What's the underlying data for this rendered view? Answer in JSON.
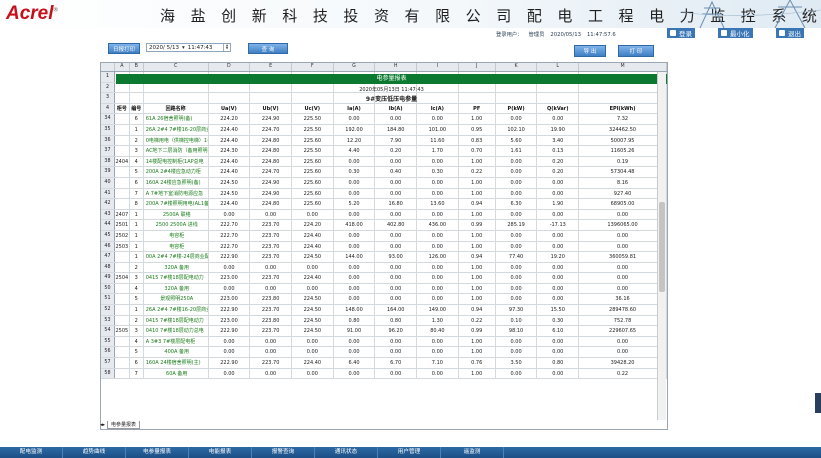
{
  "header": {
    "logo": "Acrel",
    "logo_mark": "®",
    "title": "海 盐 创 新 科 技 投 资 有 限 公 司 配 电 工 程 电 力 监 控 系 统",
    "user_label": "登录用户：",
    "user_name": "管理员",
    "date": "2020/05/13",
    "time": "11:47:57.6",
    "login": "登录",
    "minimize": "最小化",
    "logout": "退出"
  },
  "toolbar": {
    "report_type": "日报打印",
    "date_value": "2020/ 5/13",
    "time_value": "11:47:43",
    "query": "查 询",
    "export": "导 出",
    "print": "打 印"
  },
  "sheet": {
    "columns": [
      "A",
      "B",
      "C",
      "D",
      "E",
      "F",
      "G",
      "H",
      "I",
      "J",
      "K",
      "L",
      "M"
    ],
    "title": "电参量报表",
    "report_date": "2020年05月13日 11:47:43",
    "subtitle": "9#变压低压电参量",
    "headers": [
      "柜号",
      "编号",
      "回路名称",
      "Ua(V)",
      "Ub(V)",
      "Uc(V)",
      "Ia(A)",
      "Ib(A)",
      "Ic(A)",
      "PF",
      "P(kW)",
      "Q(kVar)",
      "EPI(kWh)"
    ],
    "rows": [
      {
        "rn": "34",
        "bus": "",
        "no": "6",
        "name": "61A 26宿舍照明(备)",
        "ua": "224.20",
        "ub": "224.90",
        "uc": "225.50",
        "ia": "0.00",
        "ib": "0.00",
        "ic": "0.00",
        "pf": "1.00",
        "p": "0.00",
        "q": "0.00",
        "epi": "7.32"
      },
      {
        "rn": "35",
        "bus": "",
        "no": "1",
        "name": "26A 2#4 7#楼16-20层商业配电",
        "ua": "224.40",
        "ub": "224.70",
        "uc": "225.50",
        "ia": "192.00",
        "ib": "184.80",
        "ic": "101.00",
        "pf": "0.95",
        "p": "102.10",
        "q": "19.90",
        "epi": "324462.50"
      },
      {
        "rn": "36",
        "bus": "",
        "no": "2",
        "name": "0电梯用电（供梯控电梯）1#-7",
        "ua": "224.40",
        "ub": "224.80",
        "uc": "225.60",
        "ia": "12.20",
        "ib": "7.90",
        "ic": "11.60",
        "pf": "0.83",
        "p": "5.60",
        "q": "3.40",
        "epi": "50007.95"
      },
      {
        "rn": "37",
        "bus": "",
        "no": "3",
        "name": "AC地下二层消防（备用照明）",
        "ua": "224.30",
        "ub": "224.80",
        "uc": "225.50",
        "ia": "4.40",
        "ib": "0.20",
        "ic": "1.70",
        "pf": "0.70",
        "p": "1.61",
        "q": "0.13",
        "epi": "11605.26"
      },
      {
        "rn": "38",
        "bus": "2404",
        "no": "4",
        "name": "14楼配电控制柜(1AP总电",
        "ua": "224.40",
        "ub": "224.80",
        "uc": "225.60",
        "ia": "0.00",
        "ib": "0.00",
        "ic": "0.00",
        "pf": "1.00",
        "p": "0.00",
        "q": "0.20",
        "epi": "0.19"
      },
      {
        "rn": "39",
        "bus": "",
        "no": "5",
        "name": "200A 2#4楼应急动力柜",
        "ua": "224.40",
        "ub": "224.70",
        "uc": "225.60",
        "ia": "0.30",
        "ib": "0.40",
        "ic": "0.30",
        "pf": "0.22",
        "p": "0.00",
        "q": "0.20",
        "epi": "57304.48"
      },
      {
        "rn": "40",
        "bus": "",
        "no": "6",
        "name": "160A 24楼应急照明(备)",
        "ua": "224.50",
        "ub": "224.90",
        "uc": "225.60",
        "ia": "0.00",
        "ib": "0.00",
        "ic": "0.00",
        "pf": "1.00",
        "p": "0.00",
        "q": "0.00",
        "epi": "8.16"
      },
      {
        "rn": "41",
        "bus": "",
        "no": "7",
        "name": "A 7#地下室消防电源应急",
        "ua": "224.50",
        "ub": "224.90",
        "uc": "225.60",
        "ia": "0.00",
        "ib": "0.00",
        "ic": "0.00",
        "pf": "1.00",
        "p": "0.00",
        "q": "0.00",
        "epi": "927.40"
      },
      {
        "rn": "42",
        "bus": "",
        "no": "8",
        "name": "200A 7#楼照明用电(AL1备)",
        "ua": "224.40",
        "ub": "224.80",
        "uc": "225.60",
        "ia": "5.20",
        "ib": "16.80",
        "ic": "13.60",
        "pf": "0.94",
        "p": "6.30",
        "q": "1.90",
        "epi": "68905.00"
      },
      {
        "rn": "43",
        "bus": "2407",
        "no": "1",
        "name": "2500A 联络",
        "ua": "0.00",
        "ub": "0.00",
        "uc": "0.00",
        "ia": "0.00",
        "ib": "0.00",
        "ic": "0.00",
        "pf": "1.00",
        "p": "0.00",
        "q": "0.00",
        "epi": "0.00",
        "center": true
      },
      {
        "rn": "44",
        "bus": "2501",
        "no": "1",
        "name": "2500 2500A 进线",
        "ua": "222.70",
        "ub": "223.70",
        "uc": "224.20",
        "ia": "418.00",
        "ib": "402.80",
        "ic": "436.00",
        "pf": "0.99",
        "p": "285.19",
        "q": "-17.13",
        "epi": "1396065.00",
        "center": true
      },
      {
        "rn": "45",
        "bus": "2502",
        "no": "1",
        "name": "电容柜",
        "ua": "222.70",
        "ub": "223.70",
        "uc": "224.40",
        "ia": "0.00",
        "ib": "0.00",
        "ic": "0.00",
        "pf": "1.00",
        "p": "0.00",
        "q": "0.00",
        "epi": "0.00",
        "center": true
      },
      {
        "rn": "46",
        "bus": "2503",
        "no": "1",
        "name": "电容柜",
        "ua": "222.70",
        "ub": "223.70",
        "uc": "224.40",
        "ia": "0.00",
        "ib": "0.00",
        "ic": "0.00",
        "pf": "1.00",
        "p": "0.00",
        "q": "0.00",
        "epi": "0.00",
        "center": true
      },
      {
        "rn": "47",
        "bus": "",
        "no": "1",
        "name": "00A 2#4 7#楼-24层商业配电",
        "ua": "222.90",
        "ub": "223.70",
        "uc": "224.50",
        "ia": "144.00",
        "ib": "93.00",
        "ic": "126.00",
        "pf": "0.94",
        "p": "77.40",
        "q": "19.20",
        "epi": "360059.81"
      },
      {
        "rn": "48",
        "bus": "",
        "no": "2",
        "name": "320A 备用",
        "ua": "0.00",
        "ub": "0.00",
        "uc": "0.00",
        "ia": "0.00",
        "ib": "0.00",
        "ic": "0.00",
        "pf": "1.00",
        "p": "0.00",
        "q": "0.00",
        "epi": "0.00",
        "center": true
      },
      {
        "rn": "49",
        "bus": "2504",
        "no": "3",
        "name": "0415 7#楼18层配电动力",
        "ua": "223.00",
        "ub": "223.70",
        "uc": "224.40",
        "ia": "0.00",
        "ib": "0.00",
        "ic": "0.00",
        "pf": "1.00",
        "p": "0.00",
        "q": "0.00",
        "epi": "0.00"
      },
      {
        "rn": "50",
        "bus": "",
        "no": "4",
        "name": "320A 备用",
        "ua": "0.00",
        "ub": "0.00",
        "uc": "0.00",
        "ia": "0.00",
        "ib": "0.00",
        "ic": "0.00",
        "pf": "1.00",
        "p": "0.00",
        "q": "0.00",
        "epi": "0.00",
        "center": true
      },
      {
        "rn": "51",
        "bus": "",
        "no": "5",
        "name": "景观照明250A",
        "ua": "223.00",
        "ub": "223.80",
        "uc": "224.50",
        "ia": "0.00",
        "ib": "0.00",
        "ic": "0.00",
        "pf": "1.00",
        "p": "0.00",
        "q": "0.00",
        "epi": "36.16",
        "center": true
      },
      {
        "rn": "52",
        "bus": "",
        "no": "1",
        "name": "26A 2#4 7#楼16-20层商业配电",
        "ua": "222.90",
        "ub": "223.70",
        "uc": "224.50",
        "ia": "148.00",
        "ib": "164.00",
        "ic": "149.00",
        "pf": "0.94",
        "p": "97.30",
        "q": "15.50",
        "epi": "289478.60"
      },
      {
        "rn": "53",
        "bus": "",
        "no": "2",
        "name": "0415 7#楼18层配电动力",
        "ua": "223.00",
        "ub": "223.80",
        "uc": "224.50",
        "ia": "0.80",
        "ib": "0.80",
        "ic": "1.30",
        "pf": "0.22",
        "p": "0.10",
        "q": "0.30",
        "epi": "752.78"
      },
      {
        "rn": "54",
        "bus": "2505",
        "no": "3",
        "name": "0410 7#楼18层动力总电",
        "ua": "222.90",
        "ub": "223.70",
        "uc": "224.50",
        "ia": "91.00",
        "ib": "96.20",
        "ic": "80.40",
        "pf": "0.99",
        "p": "98.10",
        "q": "6.10",
        "epi": "229607.65"
      },
      {
        "rn": "55",
        "bus": "",
        "no": "4",
        "name": "A 3#3 7#楼层配电柜",
        "ua": "0.00",
        "ub": "0.00",
        "uc": "0.00",
        "ia": "0.00",
        "ib": "0.00",
        "ic": "0.00",
        "pf": "1.00",
        "p": "0.00",
        "q": "0.00",
        "epi": "0.00"
      },
      {
        "rn": "56",
        "bus": "",
        "no": "5",
        "name": "400A 备用",
        "ua": "0.00",
        "ub": "0.00",
        "uc": "0.00",
        "ia": "0.00",
        "ib": "0.00",
        "ic": "0.00",
        "pf": "1.00",
        "p": "0.00",
        "q": "0.00",
        "epi": "0.00",
        "center": true
      },
      {
        "rn": "57",
        "bus": "",
        "no": "6",
        "name": "160A 24楼宿舍照明(主)",
        "ua": "222.90",
        "ub": "223.70",
        "uc": "224.40",
        "ia": "6.40",
        "ib": "6.70",
        "ic": "7.10",
        "pf": "0.76",
        "p": "3.50",
        "q": "0.80",
        "epi": "39428.20"
      },
      {
        "rn": "58",
        "bus": "",
        "no": "7",
        "name": "60A 备用",
        "ua": "0.00",
        "ub": "0.00",
        "uc": "0.00",
        "ia": "0.00",
        "ib": "0.00",
        "ic": "0.00",
        "pf": "1.00",
        "p": "0.00",
        "q": "0.00",
        "epi": "0.22",
        "center": true
      }
    ],
    "sheet_tab": "电参量报表"
  },
  "nav": [
    "配电监测",
    "趋势曲线",
    "电参量报表",
    "电能报表",
    "报警查询",
    "通讯状态",
    "用户管理",
    "遥监测"
  ]
}
